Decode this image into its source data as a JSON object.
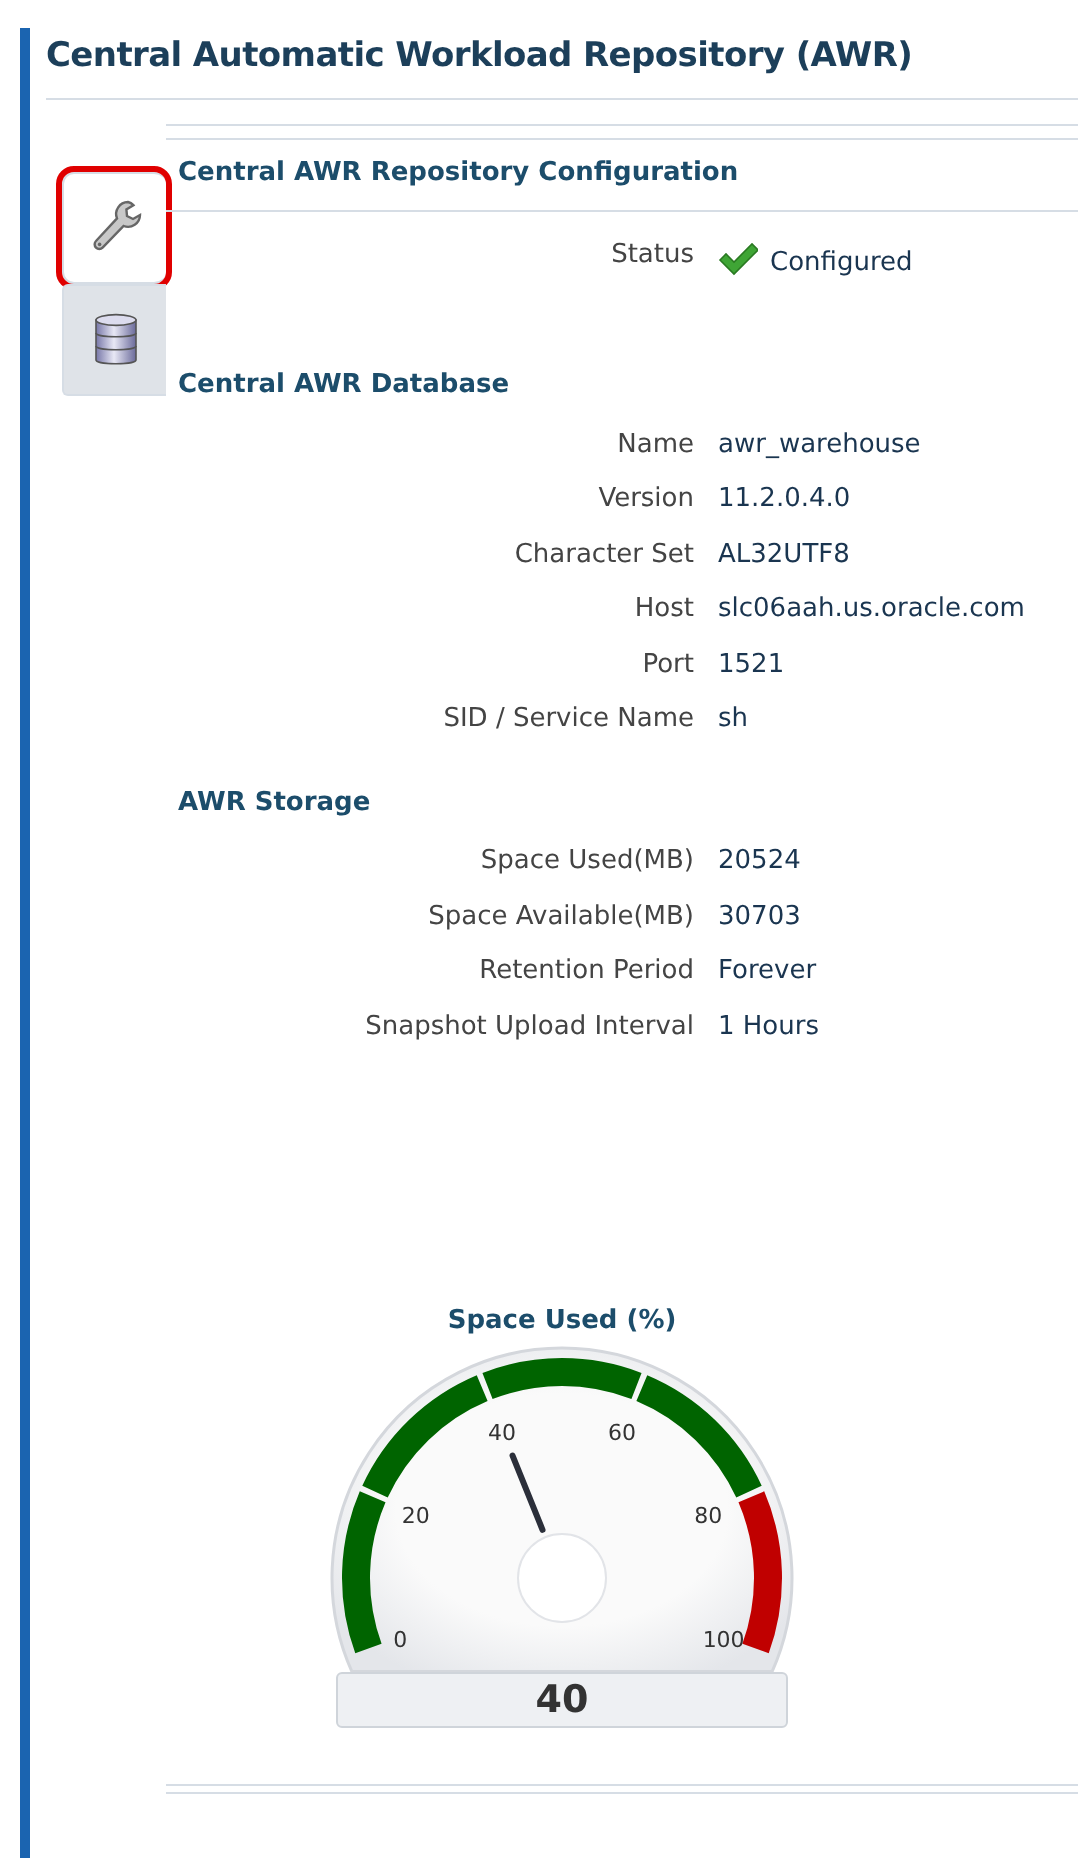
{
  "title": "Central Automatic Workload Repository (AWR)",
  "tabs": [
    {
      "kind": "wrench",
      "selected": true,
      "highlighted": true
    },
    {
      "kind": "database",
      "selected": false,
      "highlighted": false
    }
  ],
  "sections": [
    {
      "heading": "Central AWR Repository Configuration",
      "rows": [
        {
          "label": "Status",
          "value": "Configured",
          "kind": "status"
        }
      ]
    },
    {
      "heading": "Central AWR Database",
      "rows": [
        {
          "label": "Name",
          "value": "awr_warehouse",
          "kind": "text"
        },
        {
          "label": "Version",
          "value": "11.2.0.4.0",
          "kind": "text"
        },
        {
          "label": "Character Set",
          "value": "AL32UTF8",
          "kind": "text"
        },
        {
          "label": "Host",
          "value": "slc06aah.us.oracle.com",
          "kind": "text"
        },
        {
          "label": "Port",
          "value": "1521",
          "kind": "text"
        },
        {
          "label": "SID / Service Name",
          "value": "sh",
          "kind": "text"
        }
      ]
    },
    {
      "heading": "AWR Storage",
      "rows": [
        {
          "label": "Space Used(MB)",
          "value": "20524",
          "kind": "text"
        },
        {
          "label": "Space Available(MB)",
          "value": "30703",
          "kind": "text"
        },
        {
          "label": "Retention Period",
          "value": "Forever",
          "kind": "text"
        },
        {
          "label": "Snapshot Upload Interval",
          "value": "1 Hours",
          "kind": "text"
        }
      ]
    }
  ],
  "gauge": {
    "title": "Space Used (%)",
    "reading": "40",
    "tick_labels": [
      "0",
      "20",
      "40",
      "60",
      "80",
      "100"
    ],
    "segments": [
      {
        "color": "#006400"
      },
      {
        "color": "#006400"
      },
      {
        "color": "#006400"
      },
      {
        "color": "#006400"
      },
      {
        "color": "#c00000"
      }
    ]
  }
}
